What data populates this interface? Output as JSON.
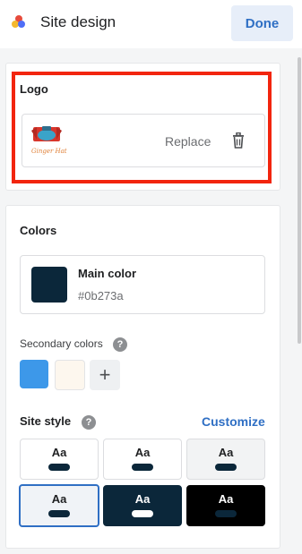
{
  "header": {
    "title": "Site design",
    "done_label": "Done"
  },
  "logo_section": {
    "label": "Logo",
    "replace_label": "Replace",
    "logo_text": "Ginger Hat"
  },
  "colors_section": {
    "label": "Colors",
    "main_color_label": "Main color",
    "main_color_hex": "#0b273a",
    "secondary_label": "Secondary colors",
    "secondary_swatches": [
      "#3d98e9",
      "#fdf7ee"
    ],
    "help_glyph": "?",
    "add_glyph": "+"
  },
  "site_style": {
    "label": "Site style",
    "customize_label": "Customize",
    "tiles": [
      {
        "text": "Aa",
        "bg": "#ffffff",
        "pill": "#0b273a",
        "color": "#1e1f21",
        "selected": false
      },
      {
        "text": "Aa",
        "bg": "#ffffff",
        "pill": "#0b273a",
        "color": "#1e1f21",
        "selected": false
      },
      {
        "text": "Aa",
        "bg": "#f2f3f4",
        "pill": "#0b273a",
        "color": "#1e1f21",
        "selected": false
      },
      {
        "text": "Aa",
        "bg": "#f0f3f7",
        "pill": "#0b273a",
        "color": "#1e1f21",
        "selected": true
      },
      {
        "text": "Aa",
        "bg": "#0b273a",
        "pill": "#ffffff",
        "color": "#ffffff",
        "selected": false
      },
      {
        "text": "Aa",
        "bg": "#000000",
        "pill": "#0b273a",
        "color": "#ffffff",
        "selected": false
      }
    ]
  },
  "colors": {
    "accent": "#2f6fc4",
    "highlight": "#f2250e"
  }
}
